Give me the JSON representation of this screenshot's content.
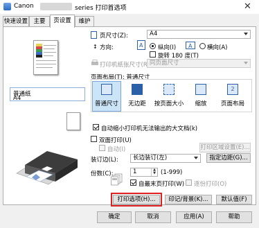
{
  "window": {
    "title_prefix": "Canon",
    "title_suffix": "series 打印首选项",
    "close_glyph": "✕"
  },
  "tabs": [
    "快速设置",
    "主要",
    "页设置",
    "维护"
  ],
  "preview": {
    "media_name": "普通纸",
    "media_size": "A4"
  },
  "page_setup": {
    "page_size_label": "页尺寸(Z):",
    "page_size_value": "A4",
    "orientation_label": "方向:",
    "portrait_label": "纵向(I)",
    "landscape_label": "横向(A)",
    "rotate_label": "旋转 180 度(T)",
    "printer_paper_label": "打印机纸张尺寸(R):",
    "printer_paper_value": "同页面尺寸",
    "page_layout_label": "页面布局(T): 普通尺寸",
    "layouts": [
      "普通尺寸",
      "无边距",
      "按页面大小",
      "缩放",
      "页面布局"
    ],
    "auto_shrink_label": "自动缩小打印机无法输出的大文档(k)",
    "duplex_label": "双面打印(U)",
    "auto_label": "自动(I)",
    "print_area_button": "打印区域设置(E)...",
    "binding_label": "装订边(L):",
    "binding_value": "长边装订(左)",
    "margin_button": "指定边距(G)...",
    "copies_label": "份数(C):",
    "copies_value": "1",
    "copies_range": "(1-999)",
    "collate_label": "自最末页打印(W)",
    "reverse_label": "逐份打印(O)",
    "print_options_button": "打印选项(H)...",
    "stamp_button": "印记/背景(K)...",
    "defaults_button": "默认值(F)"
  },
  "footer": {
    "ok": "确定",
    "cancel": "取消",
    "apply": "应用(A)",
    "help": "帮助"
  },
  "colors": {
    "highlight": "#e02020",
    "accent": "#2b5fa8"
  }
}
